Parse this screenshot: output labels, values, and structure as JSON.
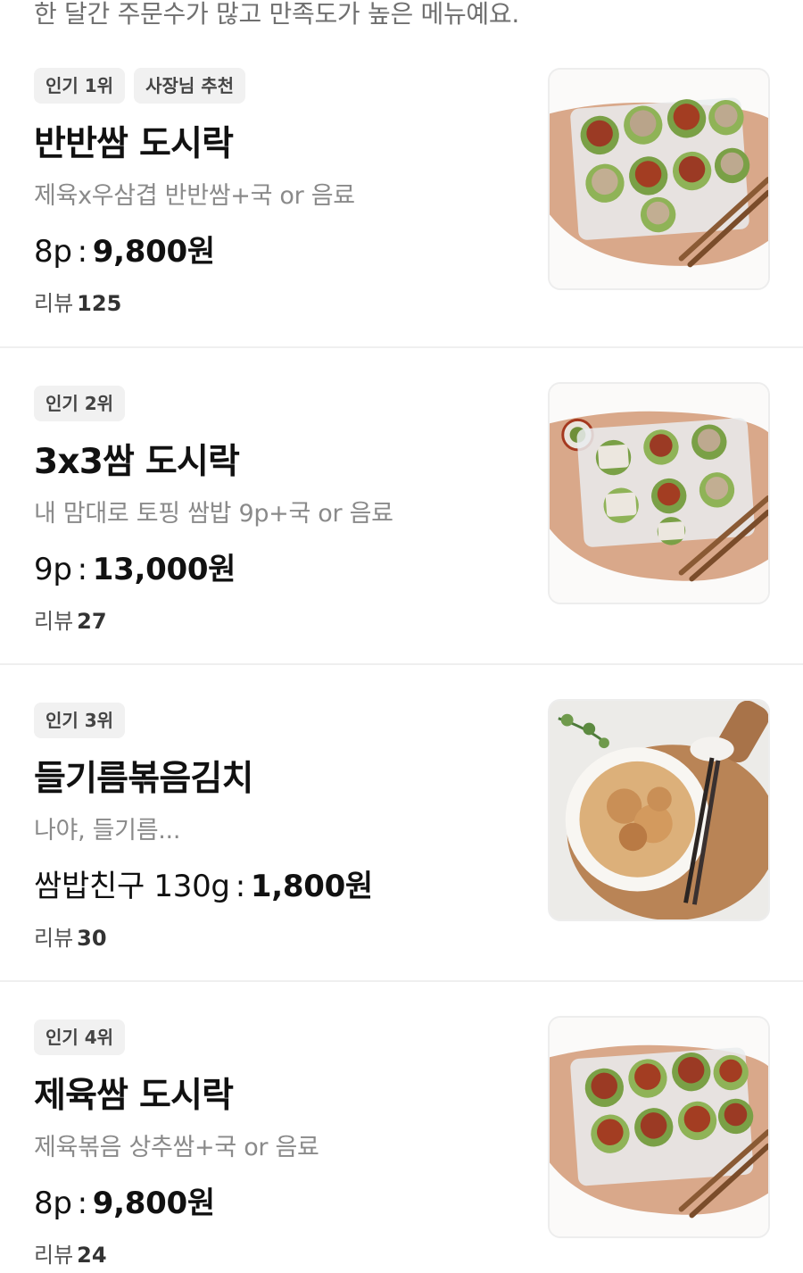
{
  "intro_text": "한 달간 주문수가 많고 만족도가 높은 메뉴예요.",
  "review_label": "리뷰",
  "menu_items": [
    {
      "badges": [
        "인기 1위",
        "사장님 추천"
      ],
      "name": "반반쌈 도시락",
      "description": "제육x우삼겹 반반쌈+국 or 음료",
      "price_prefix": "8p",
      "price": "9,800원",
      "review_count": "125",
      "image": "ssam-box-half-half"
    },
    {
      "badges": [
        "인기 2위"
      ],
      "name": "3x3쌈 도시락",
      "description": "내 맘대로 토핑 쌈밥 9p+국 or 음료",
      "price_prefix": "9p",
      "price": "13,000원",
      "review_count": "27",
      "image": "ssam-box-3x3"
    },
    {
      "badges": [
        "인기 3위"
      ],
      "name": "들기름볶음김치",
      "description": "나야, 들기름...",
      "price_prefix": "쌈밥친구 130g",
      "price": "1,800원",
      "review_count": "30",
      "image": "kimchi-bowl"
    },
    {
      "badges": [
        "인기 4위"
      ],
      "name": "제육쌈 도시락",
      "description": "제육볶음 상추쌈+국 or 음료",
      "price_prefix": "8p",
      "price": "9,800원",
      "review_count": "24",
      "image": "ssam-box-jeyuk"
    }
  ]
}
